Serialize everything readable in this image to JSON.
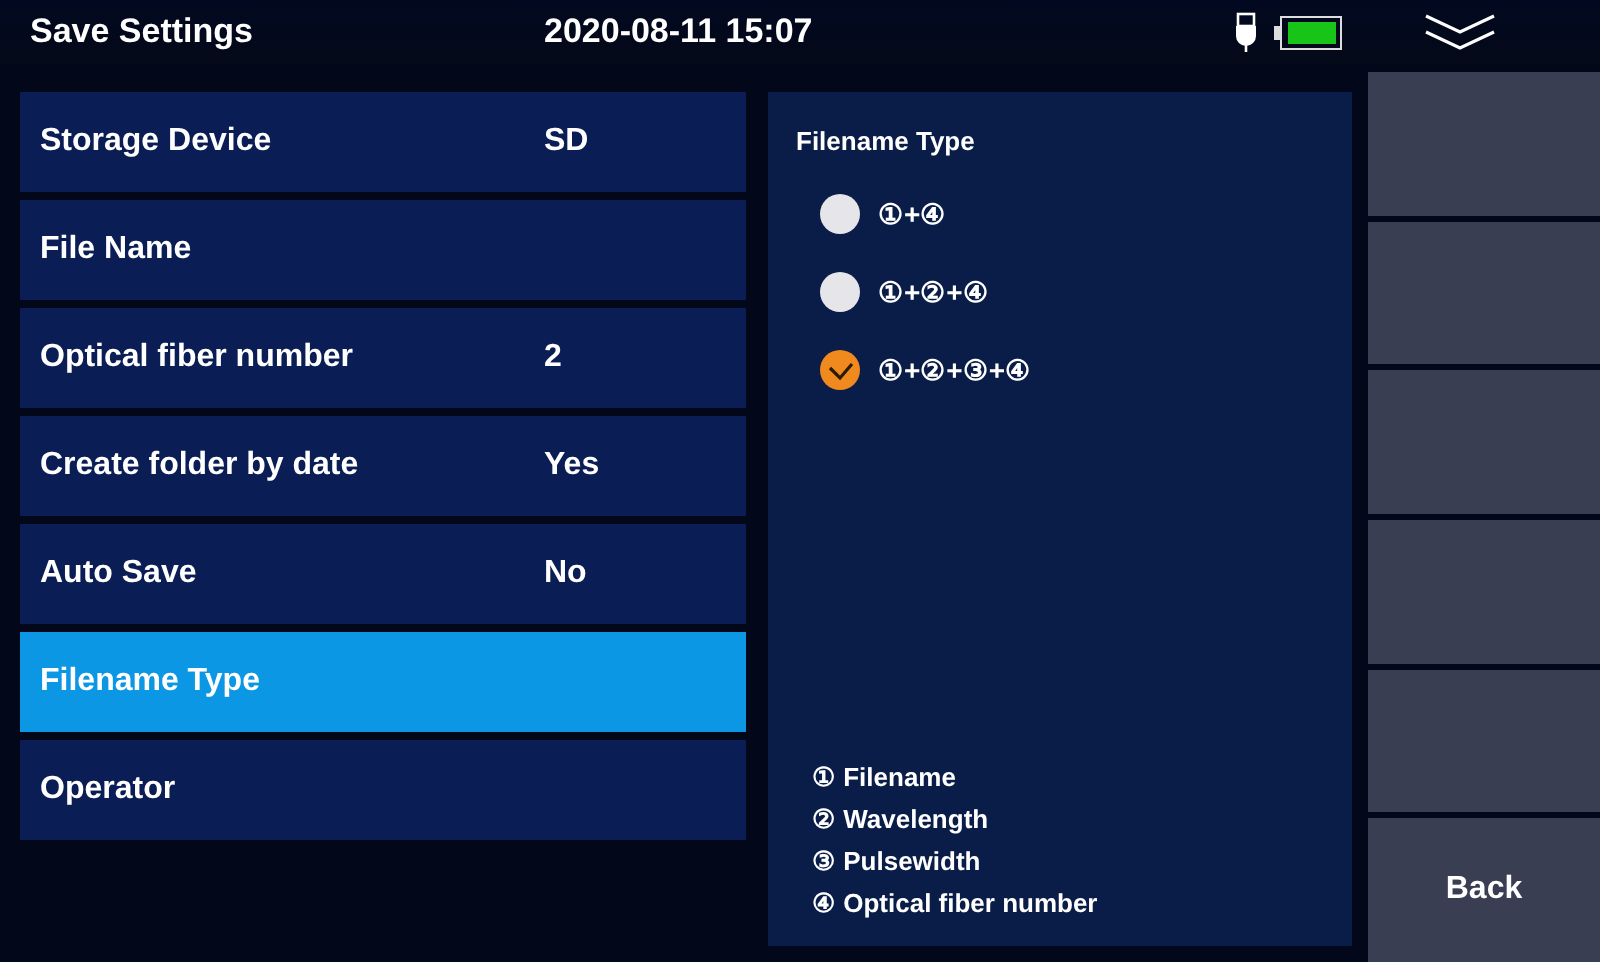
{
  "header": {
    "title": "Save Settings",
    "datetime": "2020-08-11 15:07"
  },
  "settings": [
    {
      "label": "Storage Device",
      "value": "SD",
      "selected": false
    },
    {
      "label": "File Name",
      "selected": false
    },
    {
      "label": "Optical fiber number",
      "value": "2",
      "selected": false
    },
    {
      "label": "Create folder by date",
      "value": "Yes",
      "selected": false
    },
    {
      "label": "Auto Save",
      "value": "No",
      "selected": false
    },
    {
      "label": "Filename Type",
      "selected": true
    },
    {
      "label": "Operator",
      "selected": false
    }
  ],
  "panel": {
    "title": "Filename Type",
    "options": [
      {
        "label": "①+④",
        "selected": false
      },
      {
        "label": "①+②+④",
        "selected": false
      },
      {
        "label": "①+②+③+④",
        "selected": true
      }
    ],
    "legend": [
      "① Filename",
      "② Wavelength",
      "③ Pulsewidth",
      "④ Optical fiber number"
    ]
  },
  "softkeys": [
    {
      "kind": "blank"
    },
    {
      "kind": "blank"
    },
    {
      "kind": "blank"
    },
    {
      "kind": "blank"
    },
    {
      "kind": "blank"
    },
    {
      "kind": "labeled",
      "label": "Back"
    }
  ]
}
